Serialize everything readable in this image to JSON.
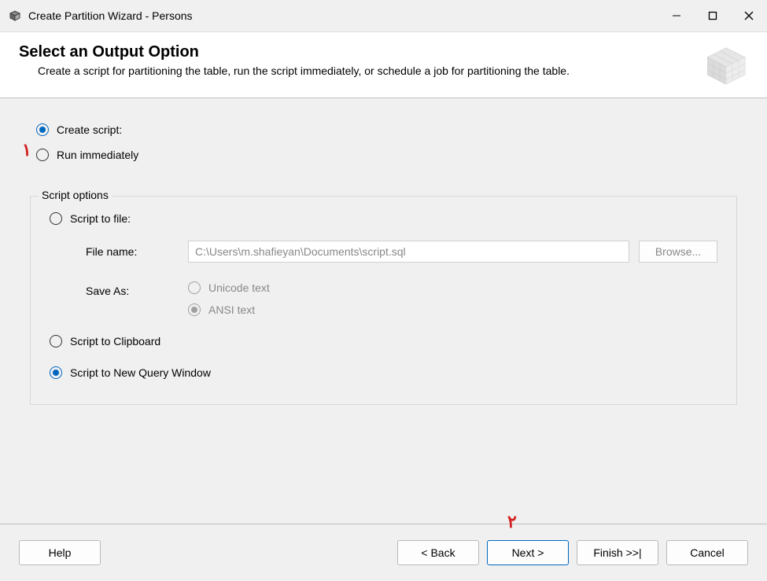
{
  "window": {
    "title": "Create Partition Wizard - Persons"
  },
  "header": {
    "title": "Select an Output Option",
    "subtitle": "Create a script for partitioning the table, run the script immediately, or schedule a job for partitioning the table."
  },
  "main_options": {
    "create_script": {
      "label": "Create script:",
      "selected": true
    },
    "run_immediately": {
      "label": "Run immediately",
      "selected": false
    }
  },
  "script_options": {
    "legend": "Script options",
    "script_to_file": {
      "label": "Script to file:",
      "selected": false
    },
    "file_name_label": "File name:",
    "file_name_value": "C:\\Users\\m.shafieyan\\Documents\\script.sql",
    "browse_label": "Browse...",
    "save_as_label": "Save As:",
    "unicode": {
      "label": "Unicode text",
      "selected": false
    },
    "ansi": {
      "label": "ANSI text",
      "selected": true
    },
    "script_to_clipboard": {
      "label": "Script to Clipboard",
      "selected": false
    },
    "script_to_new_query": {
      "label": "Script to New Query Window",
      "selected": true
    }
  },
  "footer": {
    "help": "Help",
    "back": "< Back",
    "next": "Next >",
    "finish": "Finish >>|",
    "cancel": "Cancel"
  },
  "annotations": {
    "one": "۱",
    "two": "۲"
  }
}
